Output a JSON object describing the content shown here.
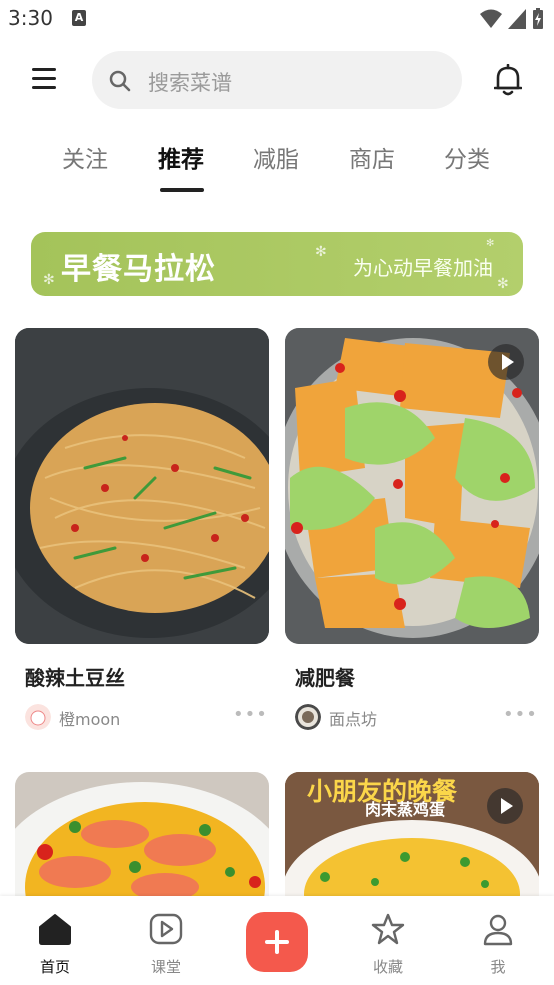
{
  "status": {
    "time": "3:30",
    "a_label": "A"
  },
  "search": {
    "placeholder": "搜索菜谱"
  },
  "tabs": [
    {
      "label": "关注"
    },
    {
      "label": "推荐",
      "active": true
    },
    {
      "label": "减脂"
    },
    {
      "label": "商店"
    },
    {
      "label": "分类"
    }
  ],
  "banner": {
    "title": "早餐马拉松",
    "subtitle": "为心动早餐加油"
  },
  "recipes": [
    {
      "title": "酸辣土豆丝",
      "author": "橙moon",
      "video": false
    },
    {
      "title": "减肥餐",
      "author": "面点坊",
      "video": true
    },
    {
      "title": "",
      "author": "",
      "video": false
    },
    {
      "title": "",
      "author": "",
      "video": true,
      "overlay_text": "小朋友的晚餐",
      "overlay_sub": "肉末蒸鸡蛋"
    }
  ],
  "nav": [
    {
      "label": "首页",
      "icon": "home-icon",
      "active": true
    },
    {
      "label": "课堂",
      "icon": "play-course-icon"
    },
    {
      "label": "",
      "icon": "plus-icon"
    },
    {
      "label": "收藏",
      "icon": "star-icon"
    },
    {
      "label": "我",
      "icon": "user-icon"
    }
  ],
  "colors": {
    "accent": "#f4594c",
    "banner": "#a9c762"
  }
}
